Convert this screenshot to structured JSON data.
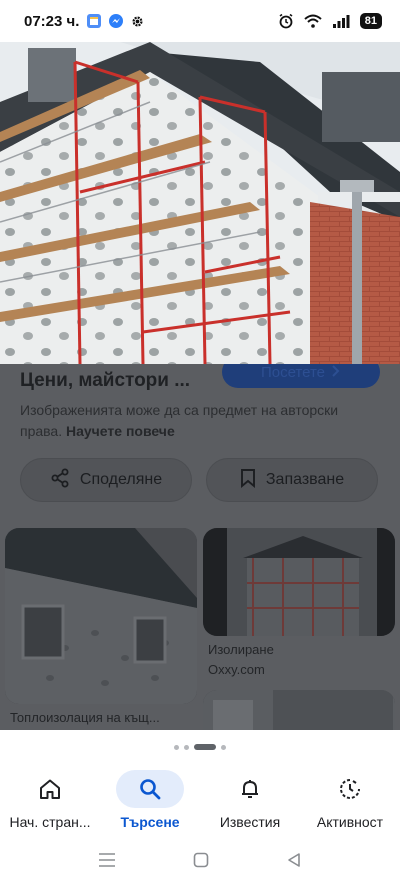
{
  "status_bar": {
    "time": "07:23 ч.",
    "battery": "81",
    "icons": [
      "calendar-app-icon",
      "messenger-icon",
      "settings-gear-icon",
      "alarm-icon",
      "wifi-icon",
      "signal-icon",
      "battery-icon"
    ]
  },
  "hero": {
    "description_icon": "house-scaffolding-insulation-image"
  },
  "result": {
    "title": "Цени, майстори ...",
    "visit_label": "Посетете",
    "copyright_text": "Изображенията може да са предмет на авторски права.",
    "learn_more": "Научете повече",
    "share_label": "Споделяне",
    "save_label": "Запазване"
  },
  "related": [
    {
      "caption": "Топлоизолация на къщ..."
    },
    {
      "caption": "Изолиране",
      "source": "Oxxy.com"
    }
  ],
  "pager": {
    "count": 4,
    "active_index": 2
  },
  "bottom_nav": {
    "items": [
      {
        "label": "Нач. стран...",
        "icon": "home-icon",
        "active": false
      },
      {
        "label": "Търсене",
        "icon": "search-icon",
        "active": true
      },
      {
        "label": "Известия",
        "icon": "bell-icon",
        "active": false
      },
      {
        "label": "Активност",
        "icon": "activity-icon",
        "active": false
      }
    ]
  },
  "colors": {
    "accent": "#0b57d0",
    "active_nav_bg": "#e3ecfb",
    "dim_overlay": "#5b5d61"
  }
}
